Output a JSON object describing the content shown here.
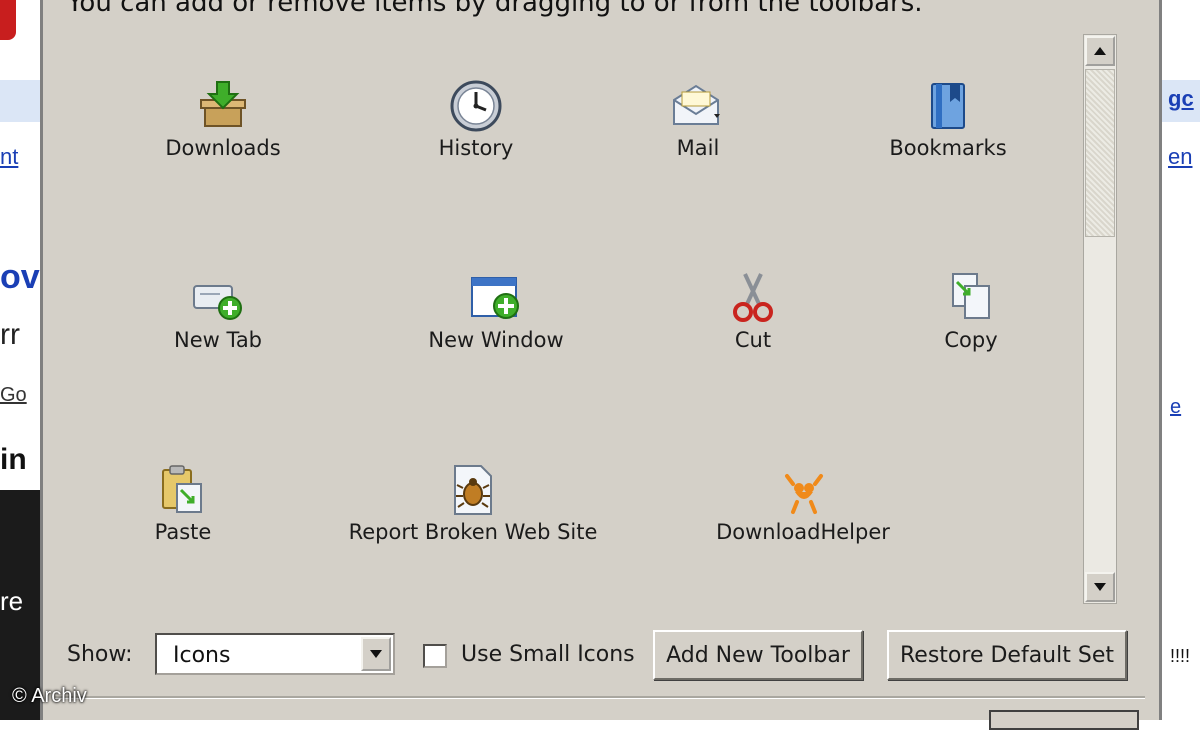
{
  "dialog": {
    "instruction": "You can add or remove items by dragging to or from the toolbars."
  },
  "palette": {
    "items": [
      {
        "label": "Downloads",
        "icon": "downloads-icon"
      },
      {
        "label": "History",
        "icon": "history-clock-icon"
      },
      {
        "label": "Mail",
        "icon": "mail-envelope-icon"
      },
      {
        "label": "Bookmarks",
        "icon": "bookmarks-book-icon"
      },
      {
        "label": "New Tab",
        "icon": "new-tab-icon"
      },
      {
        "label": "New Window",
        "icon": "new-window-icon"
      },
      {
        "label": "Cut",
        "icon": "scissors-icon"
      },
      {
        "label": "Copy",
        "icon": "copy-icon"
      },
      {
        "label": "Paste",
        "icon": "paste-clipboard-icon"
      },
      {
        "label": "Report Broken Web Site",
        "icon": "bug-report-icon"
      },
      {
        "label": "DownloadHelper",
        "icon": "downloadhelper-icon"
      }
    ]
  },
  "controls": {
    "show_label": "Show:",
    "show_value": "Icons",
    "small_icons_label": "Use Small Icons",
    "small_icons_checked": false,
    "add_toolbar_label": "Add New Toolbar",
    "restore_label": "Restore Default Set"
  },
  "background_page": {
    "left_fragments": [
      "nt",
      "ov",
      "rr",
      "Go",
      "in",
      "re"
    ],
    "right_fragments": [
      "gc",
      "en",
      "e",
      "!!!!"
    ]
  },
  "watermark": "© Archiv",
  "colors": {
    "dialog_bg": "#d4d0c8",
    "accent_green": "#3fae2a",
    "link_blue": "#1a3fb5"
  }
}
